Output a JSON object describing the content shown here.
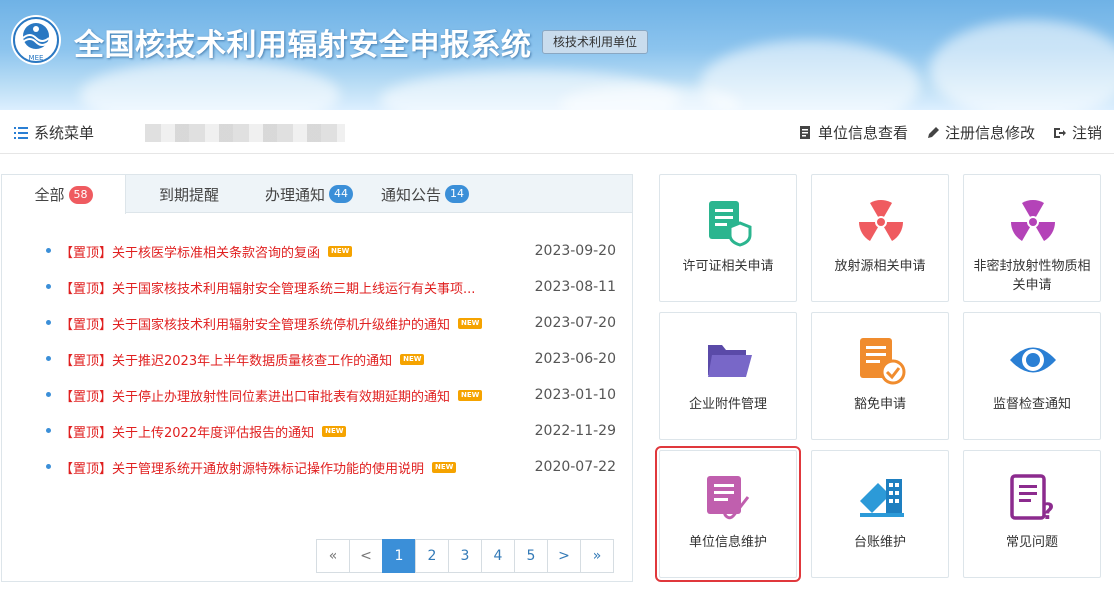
{
  "header": {
    "title": "全国核技术利用辐射安全申报系统",
    "role_tag": "核技术利用单位",
    "logo_text": "MEE"
  },
  "menubar": {
    "menu_label": "系统菜单",
    "right_items": [
      {
        "label": "单位信息查看",
        "icon": "document-icon"
      },
      {
        "label": "注册信息修改",
        "icon": "pencil-icon"
      },
      {
        "label": "注销",
        "icon": "logout-icon"
      }
    ]
  },
  "tabs": [
    {
      "label": "全部",
      "badge": "58",
      "badge_color": "red",
      "active": true
    },
    {
      "label": "到期提醒",
      "badge": null
    },
    {
      "label": "办理通知",
      "badge": "44",
      "badge_color": "blue"
    },
    {
      "label": "通知公告",
      "badge": "14",
      "badge_color": "blue"
    }
  ],
  "notices": [
    {
      "title": "【置顶】关于核医学标准相关条款咨询的复函",
      "new": true,
      "date": "2023-09-20"
    },
    {
      "title": "【置顶】关于国家核技术利用辐射安全管理系统三期上线运行有关事项...",
      "new": false,
      "date": "2023-08-11"
    },
    {
      "title": "【置顶】关于国家核技术利用辐射安全管理系统停机升级维护的通知",
      "new": true,
      "date": "2023-07-20"
    },
    {
      "title": "【置顶】关于推迟2023年上半年数据质量核查工作的通知",
      "new": true,
      "date": "2023-06-20"
    },
    {
      "title": "【置顶】关于停止办理放射性同位素进出口审批表有效期延期的通知",
      "new": true,
      "date": "2023-01-10"
    },
    {
      "title": "【置顶】关于上传2022年度评估报告的通知",
      "new": true,
      "date": "2022-11-29"
    },
    {
      "title": "【置顶】关于管理系统开通放射源特殊标记操作功能的使用说明",
      "new": true,
      "date": "2020-07-22"
    }
  ],
  "new_tag": "NEW",
  "pager": {
    "first": "«",
    "prev": "<",
    "next": ">",
    "last": "»",
    "pages": [
      "1",
      "2",
      "3",
      "4",
      "5"
    ],
    "current": "1"
  },
  "tiles": [
    {
      "label": "许可证相关申请",
      "icon": "license-shield-icon",
      "color": "#2bb58f"
    },
    {
      "label": "放射源相关申请",
      "icon": "radiation-icon",
      "color": "#ef5b60"
    },
    {
      "label": "非密封放射性物质相关申请",
      "icon": "radiation-icon",
      "color": "#b443b8"
    },
    {
      "label": "企业附件管理",
      "icon": "folder-icon",
      "color": "#7867c8"
    },
    {
      "label": "豁免申请",
      "icon": "document-check-icon",
      "color": "#f08c2e"
    },
    {
      "label": "监督检查通知",
      "icon": "eye-icon",
      "color": "#2a7fd4"
    },
    {
      "label": "单位信息维护",
      "icon": "document-clip-icon",
      "color": "#c05fae",
      "selected": true
    },
    {
      "label": "台账维护",
      "icon": "building-icon",
      "color": "#2c9ad8"
    },
    {
      "label": "常见问题",
      "icon": "question-document-icon",
      "color": "#8c2b8e"
    }
  ]
}
